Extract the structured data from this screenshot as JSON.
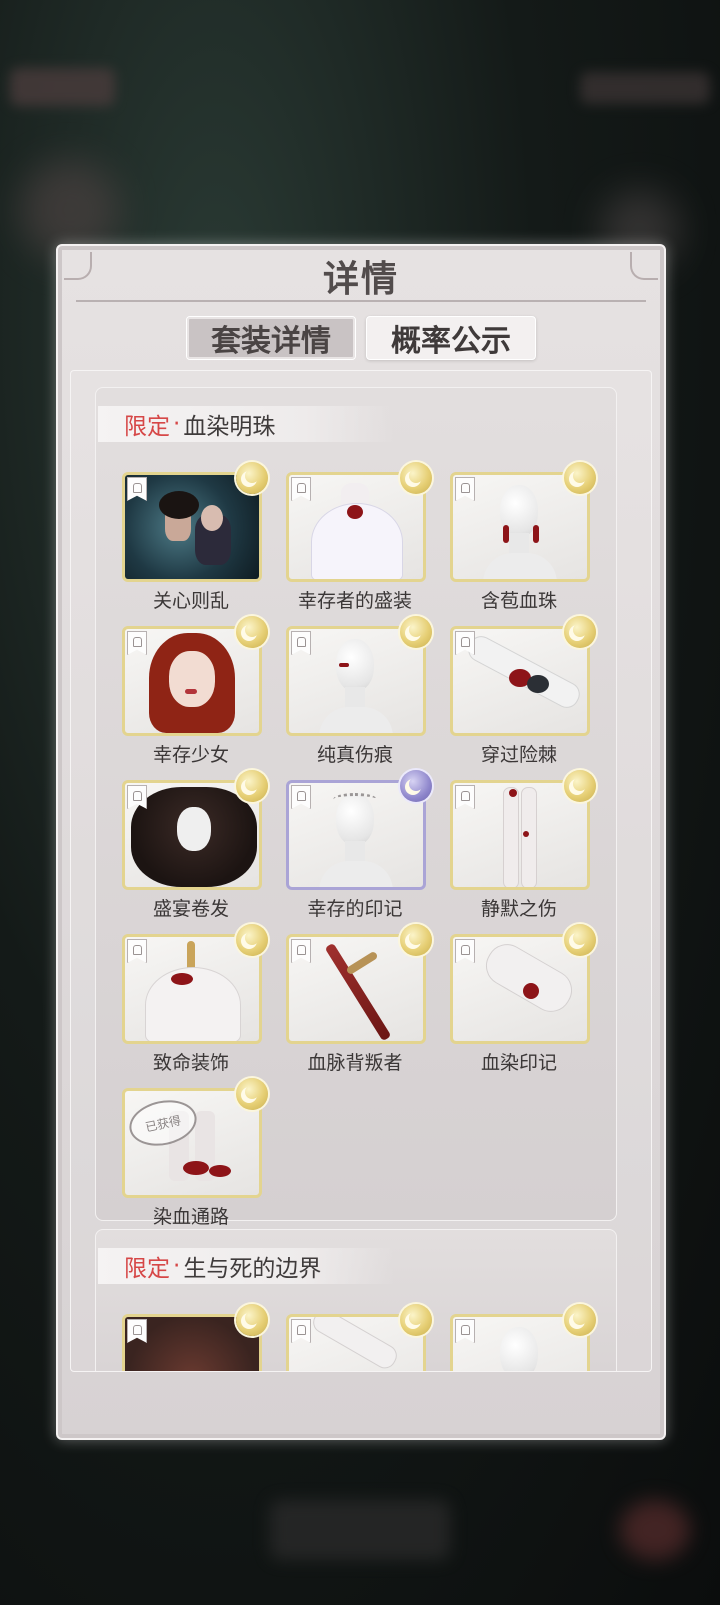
{
  "dialog": {
    "title": "详情",
    "tabs": [
      {
        "label": "套装详情",
        "active": true
      },
      {
        "label": "概率公示",
        "active": false
      }
    ]
  },
  "sections": [
    {
      "tag": "限定",
      "name": "血染明珠",
      "items": [
        {
          "label": "关心则乱",
          "rarity": "gold",
          "kind": "card-art"
        },
        {
          "label": "幸存者的盛装",
          "rarity": "gold",
          "kind": "dress"
        },
        {
          "label": "含苞血珠",
          "rarity": "gold",
          "kind": "earrings"
        },
        {
          "label": "幸存少女",
          "rarity": "gold",
          "kind": "face"
        },
        {
          "label": "纯真伤痕",
          "rarity": "gold",
          "kind": "head-scar"
        },
        {
          "label": "穿过险棘",
          "rarity": "gold",
          "kind": "glove"
        },
        {
          "label": "盛宴卷发",
          "rarity": "gold",
          "kind": "hair"
        },
        {
          "label": "幸存的印记",
          "rarity": "purple",
          "kind": "tiara"
        },
        {
          "label": "静默之伤",
          "rarity": "gold",
          "kind": "legs"
        },
        {
          "label": "致命装饰",
          "rarity": "gold",
          "kind": "necklace"
        },
        {
          "label": "血脉背叛者",
          "rarity": "gold",
          "kind": "dagger"
        },
        {
          "label": "血染印记",
          "rarity": "gold",
          "kind": "hand"
        },
        {
          "label": "染血通路",
          "rarity": "gold",
          "kind": "shoes",
          "obtained_stamp": "已获得"
        }
      ]
    },
    {
      "tag": "限定",
      "name": "生与死的边界",
      "items": [
        {
          "label": "",
          "rarity": "gold",
          "kind": "card-art-2"
        },
        {
          "label": "",
          "rarity": "gold",
          "kind": "arm"
        },
        {
          "label": "",
          "rarity": "gold",
          "kind": "head-plain"
        }
      ]
    }
  ],
  "colors": {
    "limited_red": "#d64747",
    "gold_border": "#e3d48f",
    "purple_border": "#aaa4d6"
  }
}
